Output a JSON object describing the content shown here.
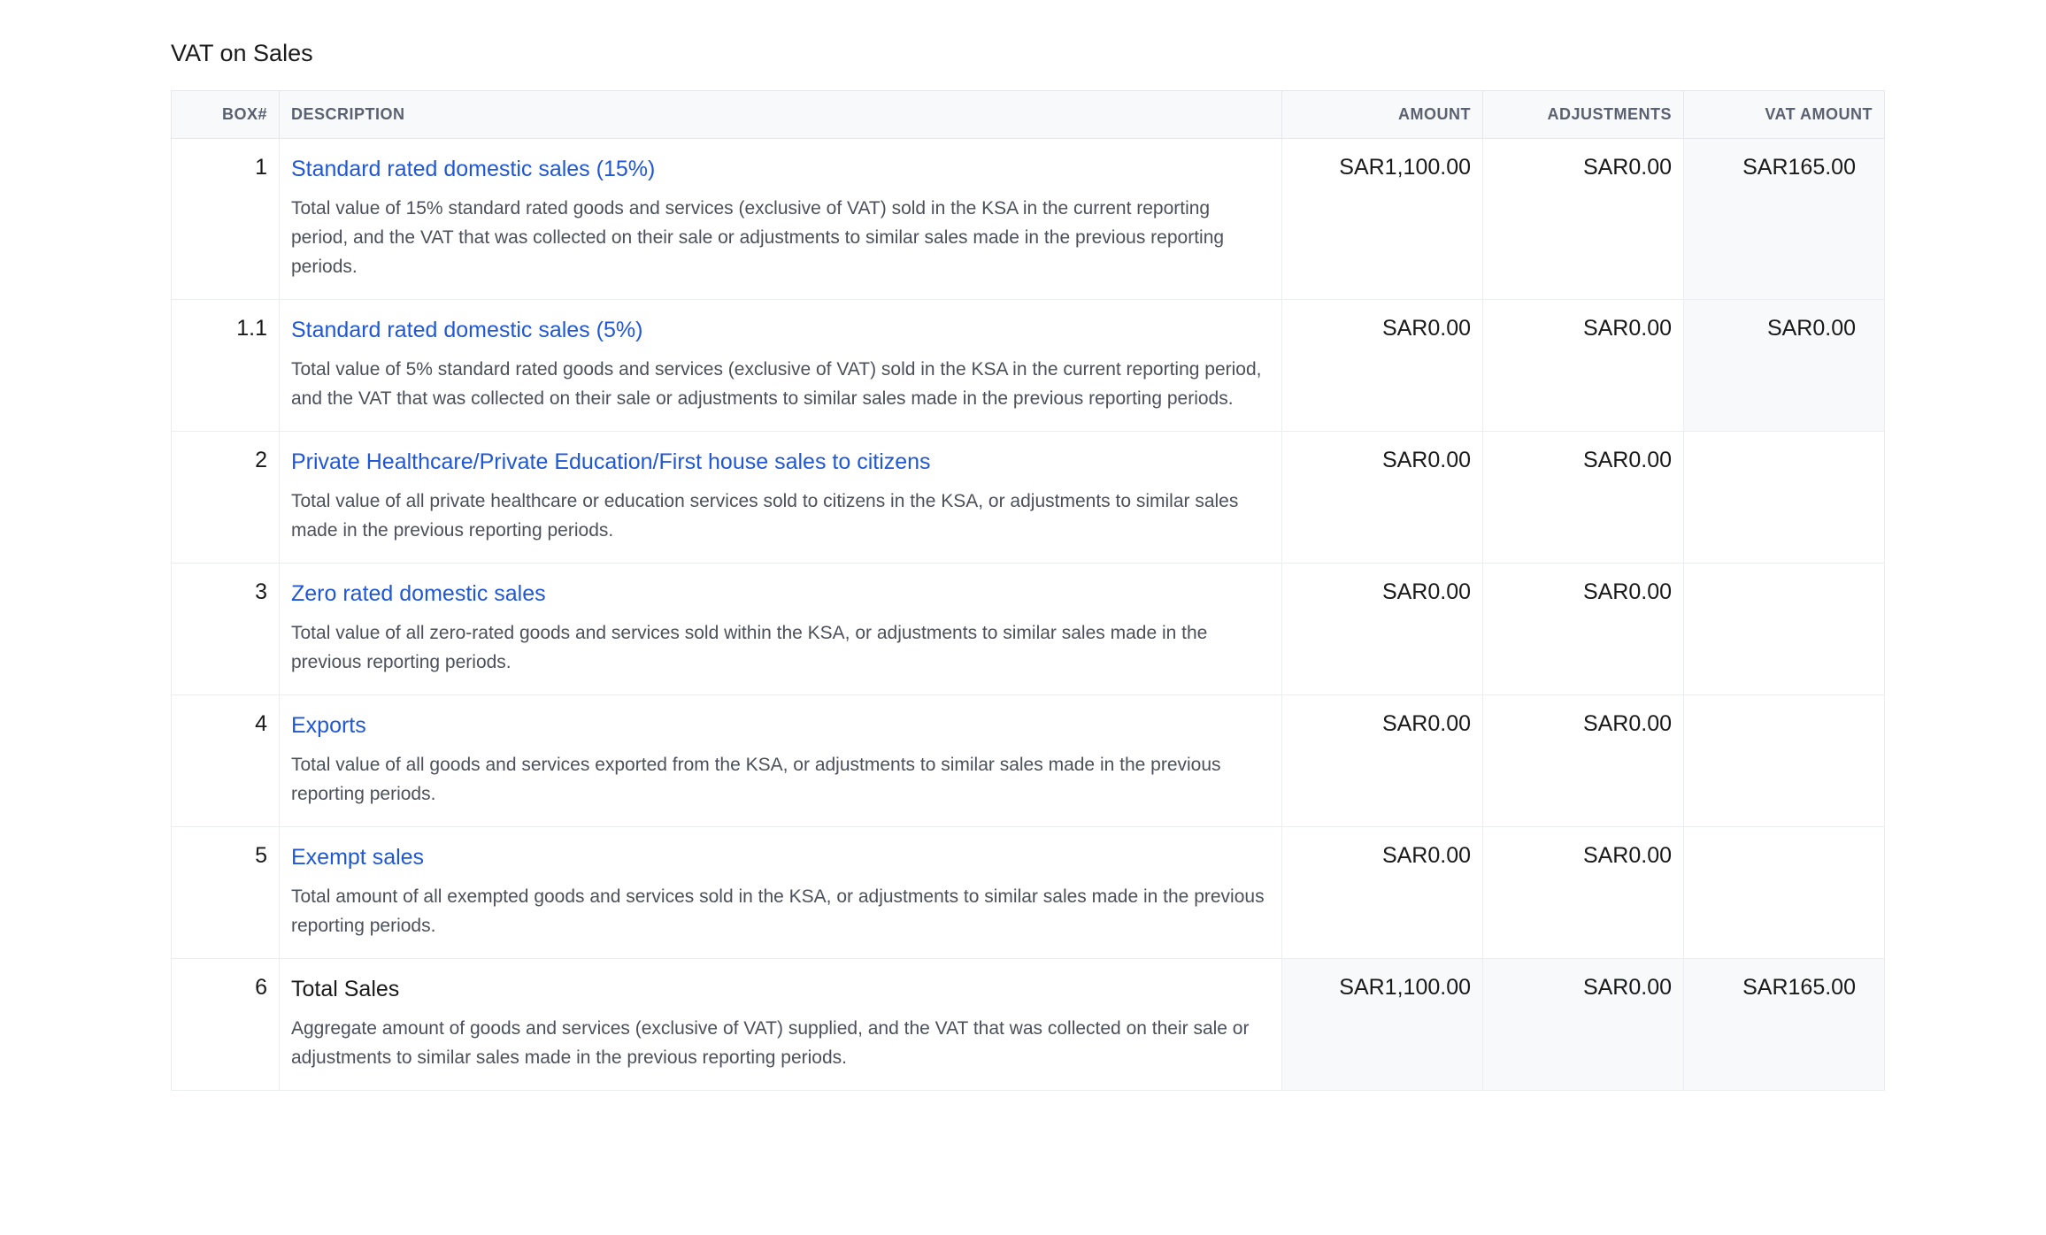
{
  "section": {
    "title": "VAT on Sales"
  },
  "table": {
    "headers": {
      "box": "BOX#",
      "description": "DESCRIPTION",
      "amount": "AMOUNT",
      "adjustments": "ADJUSTMENTS",
      "vat_amount": "VAT AMOUNT"
    },
    "rows": [
      {
        "box": "1",
        "title": "Standard rated domestic sales (15%)",
        "description": "Total value of 15% standard rated goods and services (exclusive of VAT) sold in the KSA in the current reporting period, and the VAT that was collected on their sale or adjustments to similar sales made in the previous reporting periods.",
        "amount": "SAR1,100.00",
        "adjustments": "SAR0.00",
        "vat_amount": "SAR165.00"
      },
      {
        "box": "1.1",
        "title": "Standard rated domestic sales (5%)",
        "description": "Total value of 5% standard rated goods and services (exclusive of VAT) sold in the KSA in the current reporting period, and the VAT that was collected on their sale or adjustments to similar sales made in the previous reporting periods.",
        "amount": "SAR0.00",
        "adjustments": "SAR0.00",
        "vat_amount": "SAR0.00"
      },
      {
        "box": "2",
        "title": "Private Healthcare/Private Education/First house sales to citizens",
        "description": "Total value of all private healthcare or education services sold to citizens in the KSA, or adjustments to similar sales made in the previous reporting periods.",
        "amount": "SAR0.00",
        "adjustments": "SAR0.00",
        "vat_amount": ""
      },
      {
        "box": "3",
        "title": "Zero rated domestic sales",
        "description": "Total value of all zero-rated goods and services sold within the KSA, or adjustments to similar sales made in the previous reporting periods.",
        "amount": "SAR0.00",
        "adjustments": "SAR0.00",
        "vat_amount": ""
      },
      {
        "box": "4",
        "title": "Exports",
        "description": "Total value of all goods and services exported from the KSA, or adjustments to similar sales made in the previous reporting periods.",
        "amount": "SAR0.00",
        "adjustments": "SAR0.00",
        "vat_amount": ""
      },
      {
        "box": "5",
        "title": "Exempt sales",
        "description": "Total amount of all exempted goods and services sold in the KSA, or adjustments to similar sales made in the previous reporting periods.",
        "amount": "SAR0.00",
        "adjustments": "SAR0.00",
        "vat_amount": ""
      },
      {
        "box": "6",
        "title": "Total Sales",
        "description": "Aggregate amount of goods and services (exclusive of VAT) supplied, and the VAT that was collected on their sale or adjustments to similar sales made in the previous reporting periods.",
        "amount": "SAR1,100.00",
        "adjustments": "SAR0.00",
        "vat_amount": "SAR165.00"
      }
    ]
  }
}
